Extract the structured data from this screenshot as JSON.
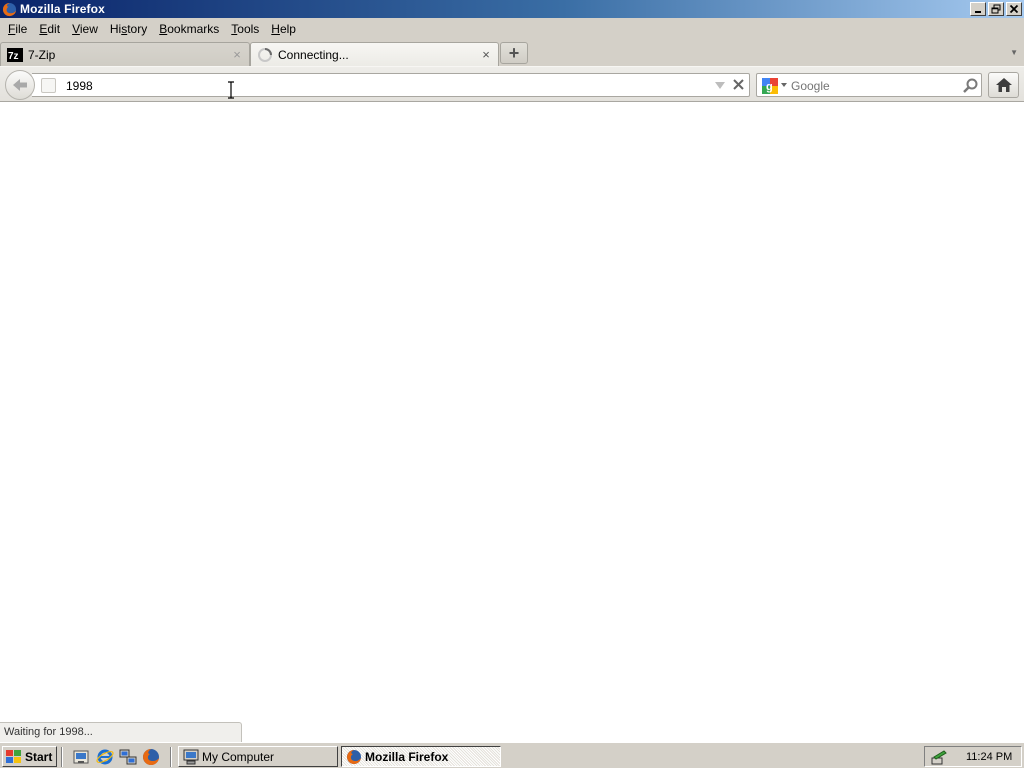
{
  "window": {
    "title": "Mozilla Firefox"
  },
  "menu": {
    "items": [
      {
        "pre": "",
        "ul": "F",
        "post": "ile"
      },
      {
        "pre": "",
        "ul": "E",
        "post": "dit"
      },
      {
        "pre": "",
        "ul": "V",
        "post": "iew"
      },
      {
        "pre": "Hi",
        "ul": "s",
        "post": "tory"
      },
      {
        "pre": "",
        "ul": "B",
        "post": "ookmarks"
      },
      {
        "pre": "",
        "ul": "T",
        "post": "ools"
      },
      {
        "pre": "",
        "ul": "H",
        "post": "elp"
      }
    ]
  },
  "tabs": [
    {
      "label": "7-Zip",
      "active": false
    },
    {
      "label": "Connecting...",
      "active": true
    }
  ],
  "tab_close_glyph": "×",
  "new_tab_glyph": "+",
  "urlbar": {
    "value": "1998"
  },
  "search": {
    "placeholder": "Google"
  },
  "status": {
    "text": "Waiting for 1998..."
  },
  "taskbar": {
    "start_label": "Start",
    "tasks": [
      {
        "label": "My Computer",
        "active": false
      },
      {
        "label": "Mozilla Firefox",
        "active": true
      }
    ],
    "clock": "11:24 PM"
  },
  "colors": {
    "title_gradient_start": "#0a246a",
    "title_gradient_end": "#a6caf0",
    "chrome_bg": "#d4d0c8",
    "search_placeholder": "#7d7d7d"
  }
}
